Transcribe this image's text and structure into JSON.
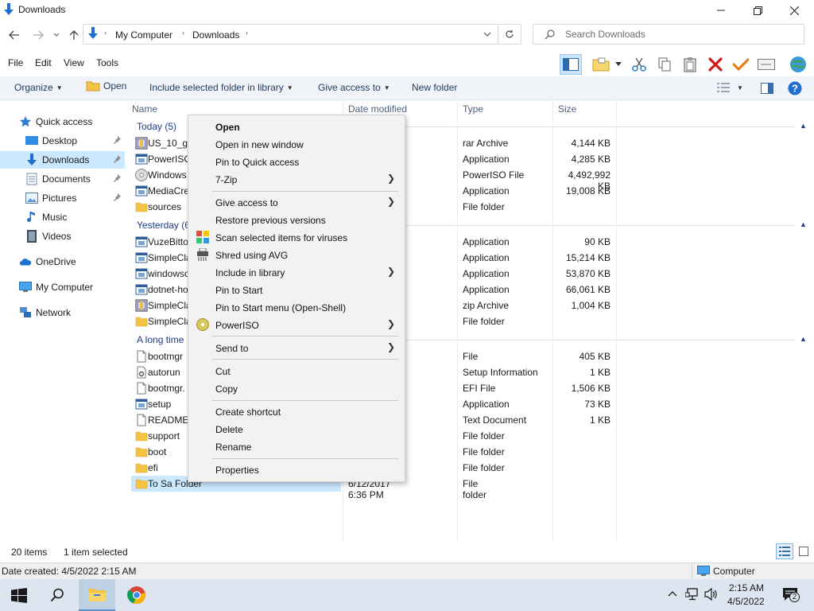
{
  "window": {
    "title": "Downloads"
  },
  "address": {
    "crumbs": [
      "My Computer",
      "Downloads"
    ]
  },
  "search": {
    "placeholder": "Search Downloads"
  },
  "menu": [
    "File",
    "Edit",
    "View",
    "Tools"
  ],
  "commands": {
    "organize": "Organize",
    "open": "Open",
    "include": "Include selected folder in library",
    "give_access": "Give access to",
    "new_folder": "New folder"
  },
  "nav": {
    "quick_access": "Quick access",
    "desktop": "Desktop",
    "downloads": "Downloads",
    "documents": "Documents",
    "pictures": "Pictures",
    "music": "Music",
    "videos": "Videos",
    "onedrive": "OneDrive",
    "my_computer": "My Computer",
    "network": "Network"
  },
  "columns": {
    "name": "Name",
    "date": "Date modified",
    "type": "Type",
    "size": "Size"
  },
  "groups": [
    {
      "label": "Today (5)",
      "rows": [
        {
          "name": "US_10_gta",
          "date": "AM",
          "type": "rar Archive",
          "size": "4,144 KB",
          "icon": "archive-icon"
        },
        {
          "name": "PowerISO",
          "date": "AM",
          "type": "Application",
          "size": "4,285 KB",
          "icon": "app-icon"
        },
        {
          "name": "Windows",
          "date": "AM",
          "type": "PowerISO File",
          "size": "4,492,992 KB",
          "icon": "disc-icon"
        },
        {
          "name": "MediaCre",
          "date": "AM",
          "type": "Application",
          "size": "19,008 KB",
          "icon": "app-icon"
        },
        {
          "name": "sources",
          "date": "AM",
          "type": "File folder",
          "size": "",
          "icon": "folder-icon"
        }
      ]
    },
    {
      "label": "Yesterday (6",
      "rows": [
        {
          "name": "VuzeBitto",
          "date": "3 PM",
          "type": "Application",
          "size": "90 KB",
          "icon": "app-icon"
        },
        {
          "name": "SimpleCla",
          "date": "7 PM",
          "type": "Application",
          "size": "15,214 KB",
          "icon": "app-icon"
        },
        {
          "name": "windowsc",
          "date": "4 PM",
          "type": "Application",
          "size": "53,870 KB",
          "icon": "app-icon"
        },
        {
          "name": "dotnet-ho",
          "date": "3 PM",
          "type": "Application",
          "size": "66,061 KB",
          "icon": "app-icon"
        },
        {
          "name": "SimpleCla",
          "date": "3 PM",
          "type": "zip Archive",
          "size": "1,004 KB",
          "icon": "archive-icon"
        },
        {
          "name": "SimpleCla",
          "date": "5 PM",
          "type": "File folder",
          "size": "",
          "icon": "folder-icon"
        }
      ]
    },
    {
      "label": "A long time",
      "rows": [
        {
          "name": "bootmgr",
          "date": "9 PM",
          "type": "File",
          "size": "405 KB",
          "icon": "file-icon"
        },
        {
          "name": "autorun",
          "date": "9 PM",
          "type": "Setup Information",
          "size": "1 KB",
          "icon": "settings-file-icon"
        },
        {
          "name": "bootmgr.",
          "date": "9 PM",
          "type": "EFI File",
          "size": "1,506 KB",
          "icon": "file-icon"
        },
        {
          "name": "setup",
          "date": "9 PM",
          "type": "Application",
          "size": "73 KB",
          "icon": "app-icon"
        },
        {
          "name": "README-",
          "date": "5 PM",
          "type": "Text Document",
          "size": "1 KB",
          "icon": "file-icon"
        },
        {
          "name": "support",
          "date": "2 PM",
          "type": "File folder",
          "size": "",
          "icon": "folder-icon"
        },
        {
          "name": "boot",
          "date": "2 PM",
          "type": "File folder",
          "size": "",
          "icon": "folder-icon"
        },
        {
          "name": "efi",
          "date": "2 PM",
          "type": "File folder",
          "size": "",
          "icon": "folder-icon"
        },
        {
          "name": "To Sa Folder",
          "date": "6/12/2017 6:36 PM",
          "type": "File folder",
          "size": "",
          "icon": "folder-icon",
          "selected": true
        }
      ]
    }
  ],
  "context_menu": {
    "open": "Open",
    "open_new_window": "Open in new window",
    "pin_quick": "Pin to Quick access",
    "zip": "7-Zip",
    "give_access": "Give access to",
    "restore": "Restore previous versions",
    "scan": "Scan selected items for viruses",
    "shred": "Shred using AVG",
    "include": "Include in library",
    "pin_start": "Pin to Start",
    "pin_start_menu": "Pin to Start menu (Open-Shell)",
    "poweriso": "PowerISO",
    "send_to": "Send to",
    "cut": "Cut",
    "copy": "Copy",
    "shortcut": "Create shortcut",
    "delete": "Delete",
    "rename": "Rename",
    "properties": "Properties"
  },
  "status": {
    "items": "20 items",
    "selected": "1 item selected",
    "date_created": "Date created: 4/5/2022 2:15 AM",
    "location": "Computer"
  },
  "taskbar": {
    "time": "2:15 AM",
    "date": "4/5/2022",
    "notifications": "2"
  }
}
